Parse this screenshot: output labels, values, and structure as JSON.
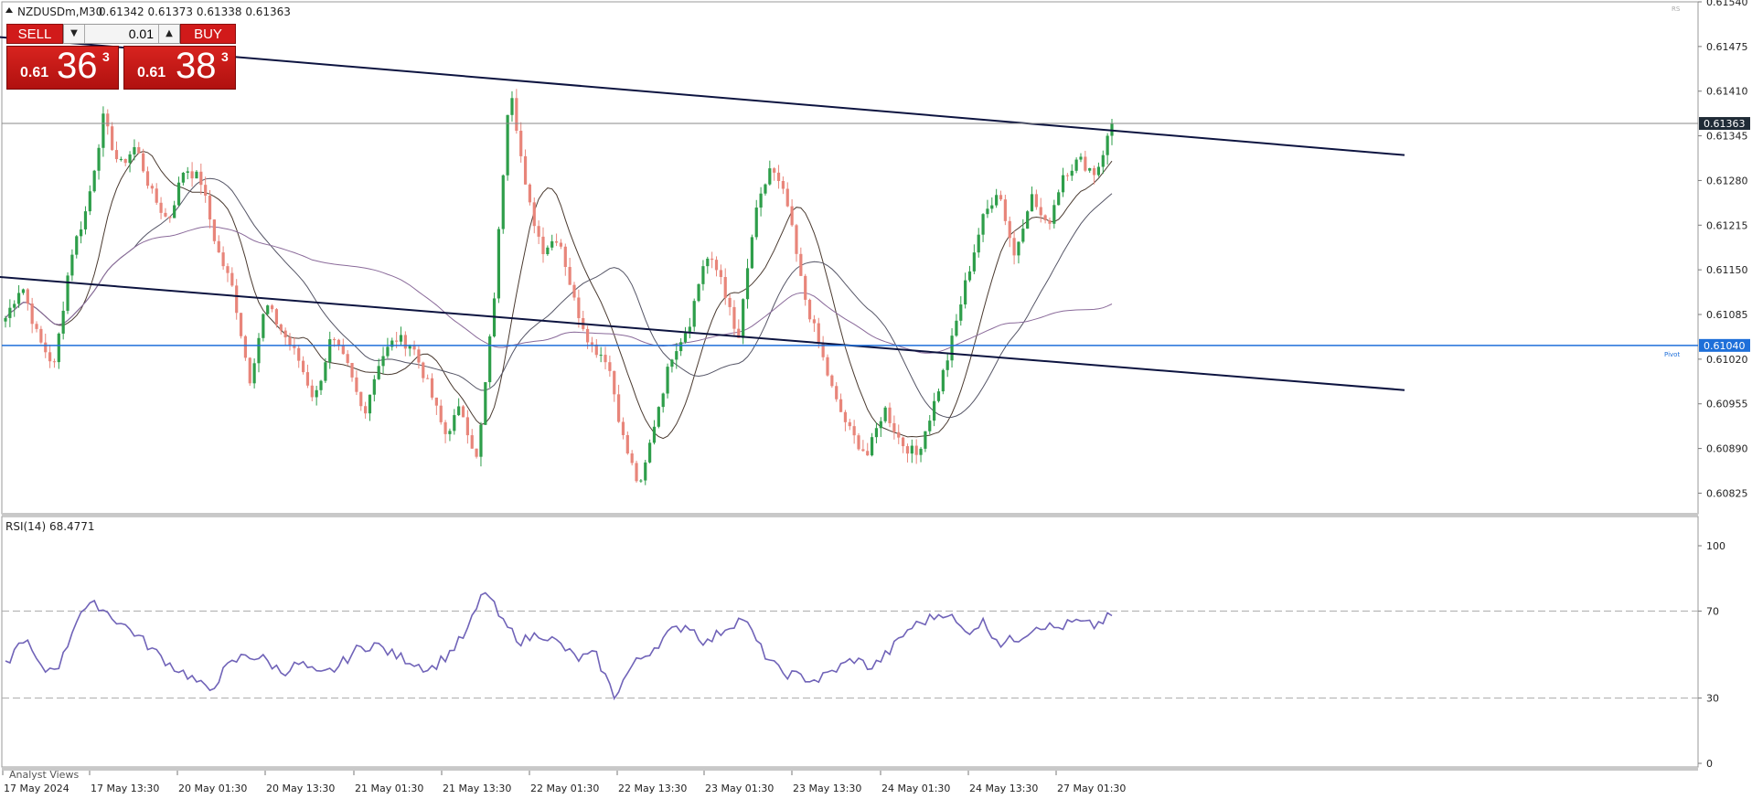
{
  "header": {
    "symbol_line": "NZDUSDm,M30",
    "ohlc": "0.61342 0.61373 0.61338 0.61363"
  },
  "trade_panel": {
    "sell_label": "SELL",
    "buy_label": "BUY",
    "lot": "0.01",
    "sell_price_small": "0.61",
    "sell_price_big": "36",
    "sell_price_sup": "3",
    "buy_price_small": "0.61",
    "buy_price_big": "38",
    "buy_price_sup": "3",
    "sell_color": "#d11a1a",
    "buy_color": "#d11a1a"
  },
  "chart_data": {
    "type": "candlestick",
    "timeframe": "M30",
    "price_axis_ticks": [
      0.6154,
      0.61475,
      0.6141,
      0.61345,
      0.6128,
      0.61215,
      0.6115,
      0.61085,
      0.6102,
      0.60955,
      0.6089,
      0.60825
    ],
    "price_range": [
      0.60795,
      0.6154
    ],
    "current_price": 0.61363,
    "current_price_label": "0.61363",
    "pivot_level": 0.6104,
    "pivot_label": "0.61040",
    "pivot_text": "Pivot",
    "colors": {
      "bull": "#2e9e4a",
      "bear": "#e8857a",
      "pivot": "#1e6fd9",
      "trendline": "#0d1440",
      "ma_fast": "#4a3a30",
      "ma_mid": "#555566",
      "ma_slow": "#8a6a9a",
      "rsi": "#7063b8"
    },
    "time_labels": [
      "17 May 2024",
      "17 May 13:30",
      "20 May 01:30",
      "20 May 13:30",
      "21 May 01:30",
      "21 May 13:30",
      "22 May 01:30",
      "22 May 13:30",
      "23 May 01:30",
      "23 May 13:30",
      "24 May 01:30",
      "24 May 13:30",
      "27 May 01:30"
    ],
    "close_anchors": [
      0.6108,
      0.6113,
      0.6105,
      0.6101,
      0.6117,
      0.6124,
      0.6137,
      0.613,
      0.6133,
      0.6126,
      0.6122,
      0.613,
      0.6128,
      0.6118,
      0.6112,
      0.6099,
      0.611,
      0.6106,
      0.6102,
      0.6096,
      0.6105,
      0.6101,
      0.6094,
      0.6102,
      0.6105,
      0.6104,
      0.6098,
      0.6091,
      0.6095,
      0.6087,
      0.611,
      0.6143,
      0.6126,
      0.6118,
      0.612,
      0.611,
      0.6104,
      0.6102,
      0.609,
      0.6083,
      0.6094,
      0.6103,
      0.6107,
      0.6117,
      0.6114,
      0.6104,
      0.6122,
      0.613,
      0.6125,
      0.6112,
      0.6104,
      0.6096,
      0.6091,
      0.6088,
      0.6095,
      0.609,
      0.6088,
      0.6095,
      0.6103,
      0.6113,
      0.6122,
      0.6127,
      0.6117,
      0.6126,
      0.6121,
      0.6129,
      0.6131,
      0.6129,
      0.6136
    ],
    "trendlines": [
      {
        "points": [
          [
            -4,
            0.61489
          ],
          [
            1536,
            0.61317
          ]
        ]
      },
      {
        "points": [
          [
            -4,
            0.6114
          ],
          [
            1536,
            0.60975
          ]
        ]
      }
    ],
    "rsi": {
      "label": "RSI(14) 68.4771",
      "ticks": [
        100,
        70,
        30,
        0
      ],
      "levels": [
        70,
        30
      ],
      "anchors": [
        45,
        58,
        42,
        46,
        70,
        73,
        66,
        60,
        52,
        45,
        40,
        33,
        44,
        50,
        48,
        42,
        46,
        40,
        44,
        52,
        55,
        50,
        47,
        43,
        50,
        60,
        80,
        64,
        56,
        60,
        55,
        48,
        50,
        31,
        45,
        52,
        60,
        64,
        55,
        62,
        67,
        52,
        42,
        40,
        38,
        43,
        48,
        44,
        52,
        62,
        66,
        70,
        60,
        65,
        55,
        58,
        64,
        62,
        65,
        63,
        68
      ]
    },
    "bottom_label": "Analyst Views"
  }
}
